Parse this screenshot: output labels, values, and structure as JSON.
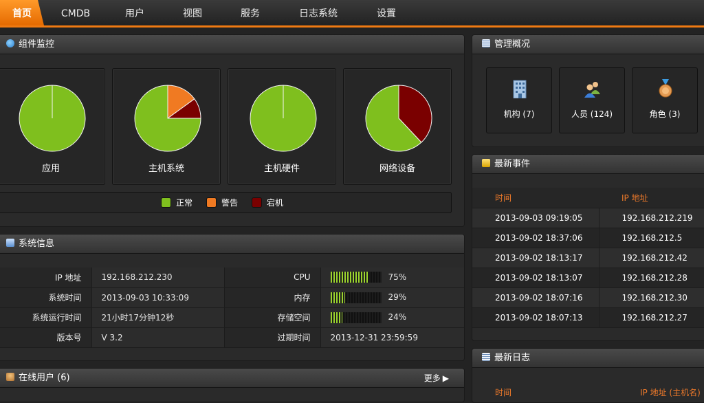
{
  "nav": {
    "items": [
      "首页",
      "CMDB",
      "用户",
      "视图",
      "服务",
      "日志系统",
      "设置"
    ],
    "active_color": "#f07a12"
  },
  "component_monitor": {
    "title": "组件监控",
    "charts": [
      {
        "label": "应用",
        "normal": 100,
        "warning": 0,
        "down": 0
      },
      {
        "label": "主机系统",
        "normal": 75,
        "warning": 15,
        "down": 10
      },
      {
        "label": "主机硬件",
        "normal": 100,
        "warning": 0,
        "down": 0
      },
      {
        "label": "网络设备",
        "normal": 62,
        "warning": 0,
        "down": 38
      }
    ],
    "legend": [
      {
        "label": "正常",
        "color": "#7fbf1e"
      },
      {
        "label": "警告",
        "color": "#f07a22"
      },
      {
        "label": "宕机",
        "color": "#7a0000"
      }
    ]
  },
  "system_info": {
    "title": "系统信息",
    "rows": [
      {
        "key": "IP 地址",
        "value": "192.168.212.230",
        "key2": "CPU",
        "meter": 75,
        "value2": "75%"
      },
      {
        "key": "系统时间",
        "value": "2013-09-03 10:33:09",
        "key2": "内存",
        "meter": 29,
        "value2": "29%"
      },
      {
        "key": "系统运行时间",
        "value": "21小时17分钟12秒",
        "key2": "存储空间",
        "meter": 24,
        "value2": "24%"
      },
      {
        "key": "版本号",
        "value": "V 3.2",
        "key2": "过期时间",
        "meter": null,
        "value2": "2013-12-31 23:59:59"
      }
    ]
  },
  "online_users": {
    "title": "在线用户 (6)",
    "more": "更多"
  },
  "management": {
    "title": "管理概况",
    "items": [
      {
        "label": "机构 (7)",
        "icon": "building-icon"
      },
      {
        "label": "人员 (124)",
        "icon": "people-icon"
      },
      {
        "label": "角色 (3)",
        "icon": "medal-icon"
      }
    ]
  },
  "latest_events": {
    "title": "最新事件",
    "headers": [
      "时间",
      "IP 地址"
    ],
    "rows": [
      [
        "2013-09-03 09:19:05",
        "192.168.212.219"
      ],
      [
        "2013-09-02 18:37:06",
        "192.168.212.5"
      ],
      [
        "2013-09-02 18:13:17",
        "192.168.212.42"
      ],
      [
        "2013-09-02 18:13:07",
        "192.168.212.28"
      ],
      [
        "2013-09-02 18:07:16",
        "192.168.212.30"
      ],
      [
        "2013-09-02 18:07:13",
        "192.168.212.27"
      ]
    ]
  },
  "latest_logs": {
    "title": "最新日志",
    "headers": [
      "时间",
      "IP 地址 (主机名)"
    ]
  }
}
